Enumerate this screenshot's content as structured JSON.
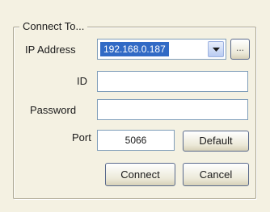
{
  "group": {
    "title": "Connect To..."
  },
  "ip": {
    "label": "IP Address",
    "value": "192.168.0.187",
    "browse_label": "..."
  },
  "id": {
    "label": "ID",
    "value": ""
  },
  "password": {
    "label": "Password",
    "value": ""
  },
  "port": {
    "label": "Port",
    "value": "5066",
    "default_label": "Default"
  },
  "actions": {
    "connect_label": "Connect",
    "cancel_label": "Cancel"
  },
  "icons": {
    "dropdown": "chevron-down-icon"
  },
  "colors": {
    "background": "#f4f1e2",
    "selection": "#316ac5",
    "field_border": "#7f9db9"
  }
}
